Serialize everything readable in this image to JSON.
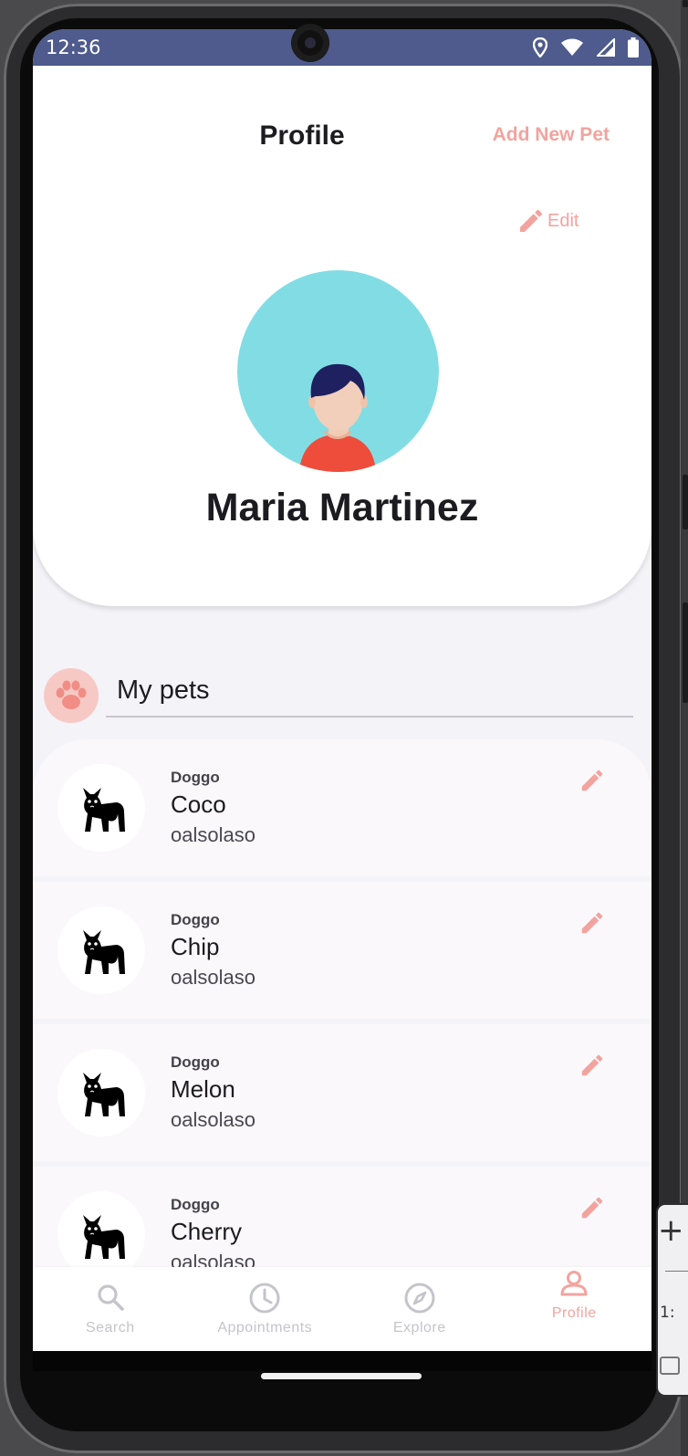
{
  "status_bar": {
    "time": "12:36",
    "icons": [
      "location-icon",
      "wifi-icon",
      "signal-icon",
      "battery-icon"
    ]
  },
  "header": {
    "title": "Profile",
    "add_new_pet_label": "Add New Pet",
    "edit_label": "Edit"
  },
  "user": {
    "name": "Maria Martinez"
  },
  "pets_section": {
    "title": "My pets",
    "items": [
      {
        "breed": "Doggo",
        "name": "Coco",
        "owner": "oalsolaso"
      },
      {
        "breed": "Doggo",
        "name": "Chip",
        "owner": "oalsolaso"
      },
      {
        "breed": "Doggo",
        "name": "Melon",
        "owner": "oalsolaso"
      },
      {
        "breed": "Doggo",
        "name": "Cherry",
        "owner": "oalsolaso"
      }
    ]
  },
  "bottom_nav": {
    "items": [
      {
        "label": "Search",
        "icon": "search-icon",
        "active": false
      },
      {
        "label": "Appointments",
        "icon": "clock-icon",
        "active": false
      },
      {
        "label": "Explore",
        "icon": "compass-icon",
        "active": false
      },
      {
        "label": "Profile",
        "icon": "person-icon",
        "active": true
      }
    ]
  },
  "emulator_panel": {
    "ratio_label": "1:"
  },
  "colors": {
    "status_bar": "#4e5b8c",
    "accent": "#f3a39e",
    "avatar_bg": "#81dde3",
    "background": "#f4f3f8"
  }
}
